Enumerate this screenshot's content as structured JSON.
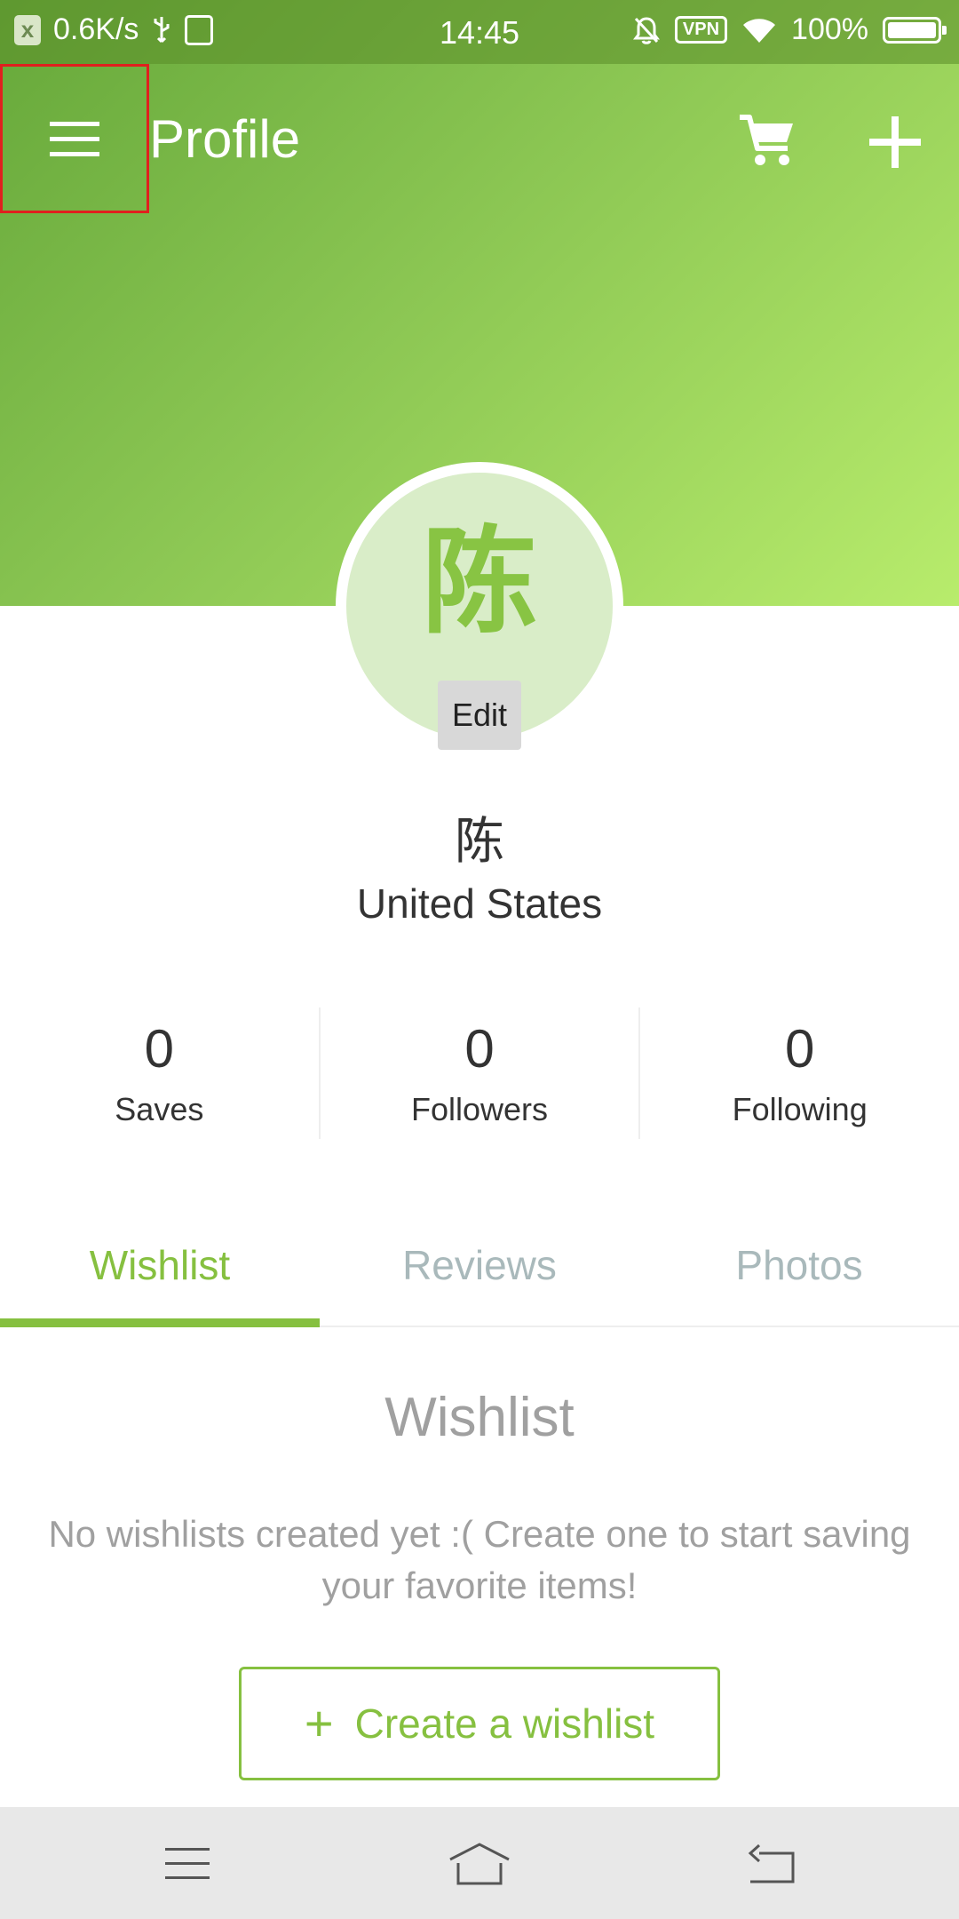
{
  "status_bar": {
    "net_speed": "0.6K/s",
    "time": "14:45",
    "vpn": "VPN",
    "battery": "100%"
  },
  "app_bar": {
    "title": "Profile"
  },
  "profile": {
    "avatar_initial": "陈",
    "edit_label": "Edit",
    "name": "陈",
    "country": "United States"
  },
  "stats": [
    {
      "value": "0",
      "label": "Saves"
    },
    {
      "value": "0",
      "label": "Followers"
    },
    {
      "value": "0",
      "label": "Following"
    }
  ],
  "tabs": [
    {
      "label": "Wishlist",
      "active": true
    },
    {
      "label": "Reviews",
      "active": false
    },
    {
      "label": "Photos",
      "active": false
    }
  ],
  "wishlist": {
    "title": "Wishlist",
    "empty_message": "No wishlists created yet :( Create one to start saving your favorite items!",
    "create_plus": "+",
    "create_label": "Create a wishlist"
  },
  "colors": {
    "accent": "#86c040",
    "header_gradient_start": "#66a83a",
    "header_gradient_end": "#b8ec6c",
    "highlight_box": "#e0201e"
  }
}
